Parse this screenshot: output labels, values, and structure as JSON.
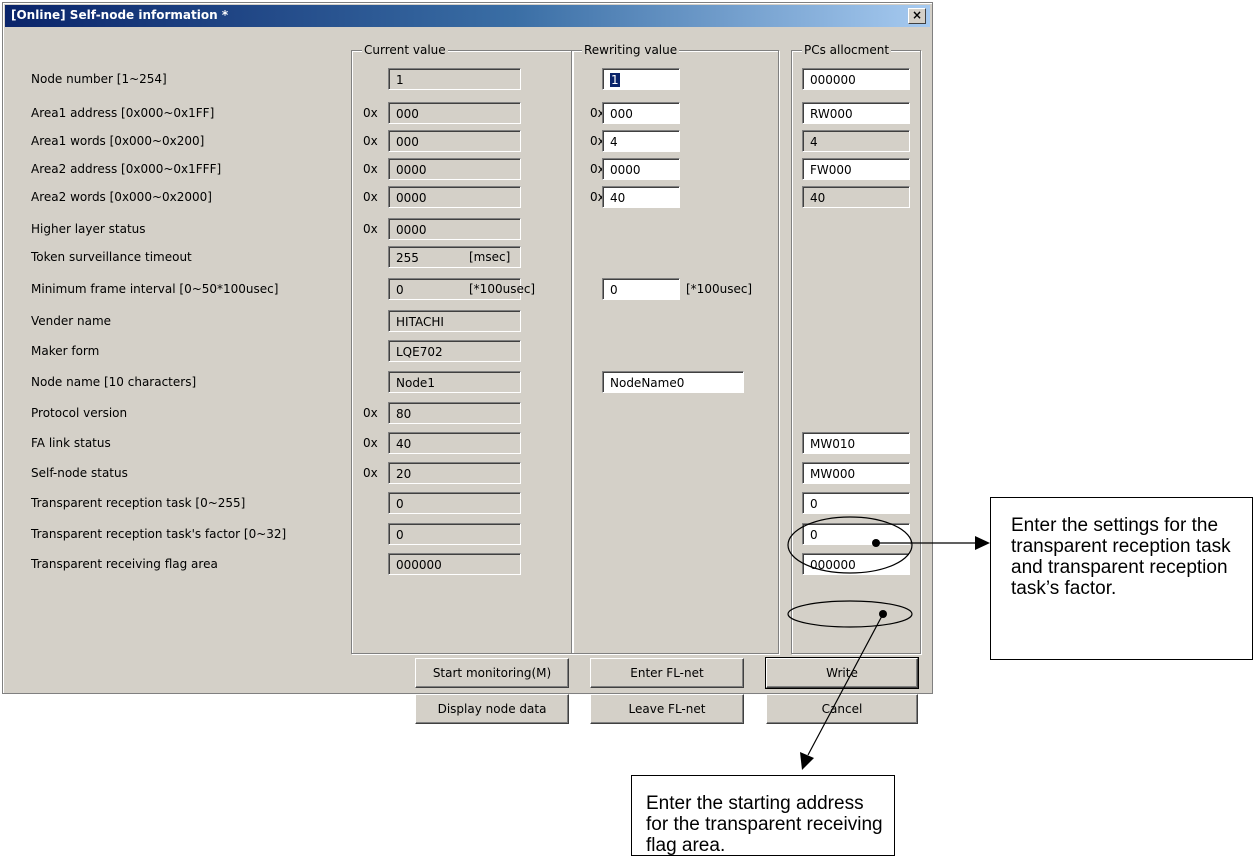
{
  "window": {
    "title": "[Online] Self-node information *",
    "close_label": "×"
  },
  "groups": {
    "current": "Current value",
    "rewriting": "Rewriting value",
    "pcs": "PCs allocment"
  },
  "hex_prefix": "0x",
  "rows": [
    {
      "label": "Node number [1~254]",
      "current": "1",
      "current_hex": false,
      "rewrite": "1",
      "rewrite_hex": false,
      "pcs": "000000",
      "pcs_edit": true
    },
    {
      "label": "Area1 address [0x000~0x1FF]",
      "current": "000",
      "current_hex": true,
      "rewrite": "000",
      "rewrite_hex": true,
      "pcs": "RW000",
      "pcs_edit": true
    },
    {
      "label": "Area1 words [0x000~0x200]",
      "current": "000",
      "current_hex": true,
      "rewrite": "4",
      "rewrite_hex": true,
      "pcs": "4",
      "pcs_edit": false
    },
    {
      "label": "Area2 address [0x000~0x1FFF]",
      "current": "0000",
      "current_hex": true,
      "rewrite": "0000",
      "rewrite_hex": true,
      "pcs": "FW000",
      "pcs_edit": true
    },
    {
      "label": "Area2 words [0x000~0x2000]",
      "current": "0000",
      "current_hex": true,
      "rewrite": "40",
      "rewrite_hex": true,
      "pcs": "40",
      "pcs_edit": false
    },
    {
      "label": "Higher layer status",
      "current": "0000",
      "current_hex": true
    },
    {
      "label": "Token surveillance timeout",
      "current": "255",
      "current_hex": false,
      "current_unit": "[msec]"
    },
    {
      "label": "Minimum frame interval  [0~50*100usec]",
      "current": "0",
      "current_hex": false,
      "current_unit": "[*100usec]",
      "rewrite": "0",
      "rewrite_hex": false,
      "rewrite_unit": "[*100usec]"
    },
    {
      "label": "Vender name",
      "current": "HITACHI",
      "current_hex": false
    },
    {
      "label": "Maker form",
      "current": "LQE702",
      "current_hex": false
    },
    {
      "label": "Node name [10 characters]",
      "current": "Node1",
      "current_hex": false,
      "rewrite": "NodeName0",
      "rewrite_hex": false
    },
    {
      "label": "Protocol version",
      "current": "80",
      "current_hex": true
    },
    {
      "label": "FA link status",
      "current": "40",
      "current_hex": true,
      "pcs": "MW010",
      "pcs_edit": true
    },
    {
      "label": "Self-node status",
      "current": "20",
      "current_hex": true,
      "pcs": "MW000",
      "pcs_edit": true
    },
    {
      "label": "Transparent reception task [0~255]",
      "current": "0",
      "current_hex": false,
      "pcs": "0",
      "pcs_edit": true
    },
    {
      "label": "Transparent reception task's factor [0~32]",
      "current": "0",
      "current_hex": false,
      "pcs": "0",
      "pcs_edit": true
    },
    {
      "label": "Transparent receiving flag area",
      "current": "000000",
      "current_hex": false,
      "pcs": "000000",
      "pcs_edit": true
    }
  ],
  "buttons": {
    "start_monitoring": "Start monitoring(M)",
    "display_node_data": "Display node data",
    "enter_flnet": "Enter FL-net",
    "leave_flnet": "Leave FL-net",
    "write": "Write",
    "cancel": "Cancel"
  },
  "callouts": {
    "task": "Enter the settings for the transparent reception task and transparent reception task’s factor.",
    "flag": "Enter the starting address for the transparent receiving flag area."
  }
}
